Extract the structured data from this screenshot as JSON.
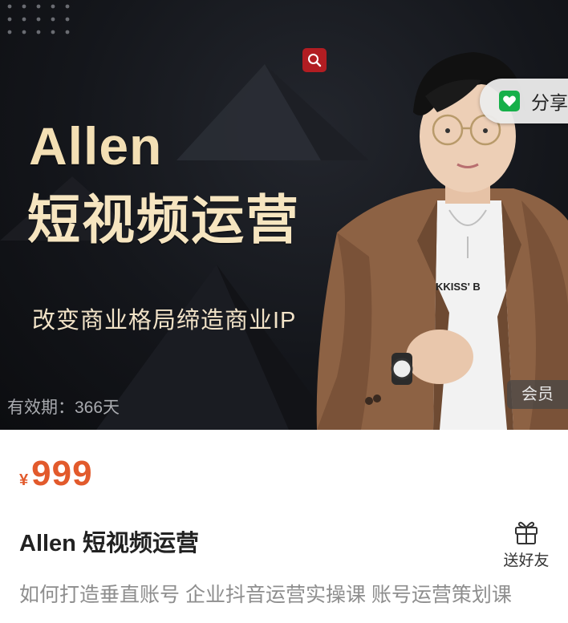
{
  "banner": {
    "title": "Allen",
    "subtitle": "短视频运营",
    "slogan": "改变商业格局缔造商业IP",
    "validity": "有效期：366天",
    "member_badge": "会员",
    "shirt_text": "KKISS' B"
  },
  "share": {
    "label": "分享",
    "icon": "wechat-icon"
  },
  "search": {
    "icon": "search-icon"
  },
  "product": {
    "currency": "¥",
    "price": "999",
    "title": "Allen 短视频运营",
    "description": "如何打造垂直账号 企业抖音运营实操课 账号运营策划课"
  },
  "gift": {
    "label": "送好友",
    "icon": "gift-icon"
  },
  "colors": {
    "price": "#e25a2c",
    "banner_text": "#f3dfb4",
    "search_button": "#b21d22",
    "share_icon": "#17b04a"
  }
}
